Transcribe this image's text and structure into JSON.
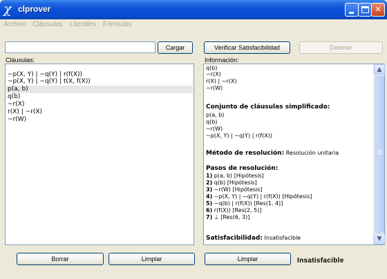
{
  "window": {
    "title": "clprover",
    "icon_glyph": "χ",
    "buttons": [
      "minimize-icon",
      "maximize-icon",
      "close-icon"
    ]
  },
  "menu": [
    "Archivo",
    "Cláusulas",
    "Literales",
    "Fórmulas"
  ],
  "input": {
    "value": "",
    "placeholder": ""
  },
  "buttons": {
    "load": "Cargar",
    "check_sat": "Verificar Satisfacibilidad",
    "stop": "Detener",
    "delete": "Borrar",
    "clear_left": "Limpiar",
    "clear_right": "Limpiar"
  },
  "clauses_panel": {
    "label": "Cláusulas:",
    "items": [
      "~p(X, Y) | ~q(Y) | r(f(X))",
      "~p(X, Y) | ~q(Y) | t(X, f(X))",
      "p(a, b)",
      "q(b)",
      "~r(X)",
      "r(X) | ~r(X)",
      "~r(W)"
    ],
    "selected_index": 2
  },
  "info_panel": {
    "label": "Información:",
    "top_lines": [
      "q(b)",
      "~r(X)",
      "r(X) | ~r(X)",
      "~r(W)"
    ],
    "simplified_title": "Conjunto de cláusulas simplificado:",
    "simplified": [
      "p(a, b)",
      "q(b)",
      "~r(W)",
      "~p(X, Y) | ~q(Y) | r(f(X))"
    ],
    "method_label": "Método de resolución:",
    "method_value": "Resolución unitaria",
    "steps_title": "Pasos de resolución:",
    "steps": [
      {
        "num": "1)",
        "text": "p(a, b)   [Hipótesis]"
      },
      {
        "num": "2)",
        "text": "q(b)   [Hipótesis]"
      },
      {
        "num": "3)",
        "text": "~r(W)   [Hipótesis]"
      },
      {
        "num": "4)",
        "text": "~p(X, Y) | ~q(Y) | r(f(X))   [Hipótesis]"
      },
      {
        "num": "5)",
        "text": "~q(b) | r(f(X))   [Res(1, 4)]"
      },
      {
        "num": "6)",
        "text": "r(f(X))   [Res(2, 5)]"
      },
      {
        "num": "7)",
        "text": "⊥   [Res(6, 3)]"
      }
    ],
    "sat_label": "Satisfacibilidad:",
    "sat_value": "Insatisfacible"
  },
  "result": "Insatisfacible",
  "colors": {
    "titlebar": "#0a4fd6",
    "window_bg": "#ece9d8",
    "panel_border": "#7f9db9",
    "selected_row": "#e6e6e6"
  }
}
